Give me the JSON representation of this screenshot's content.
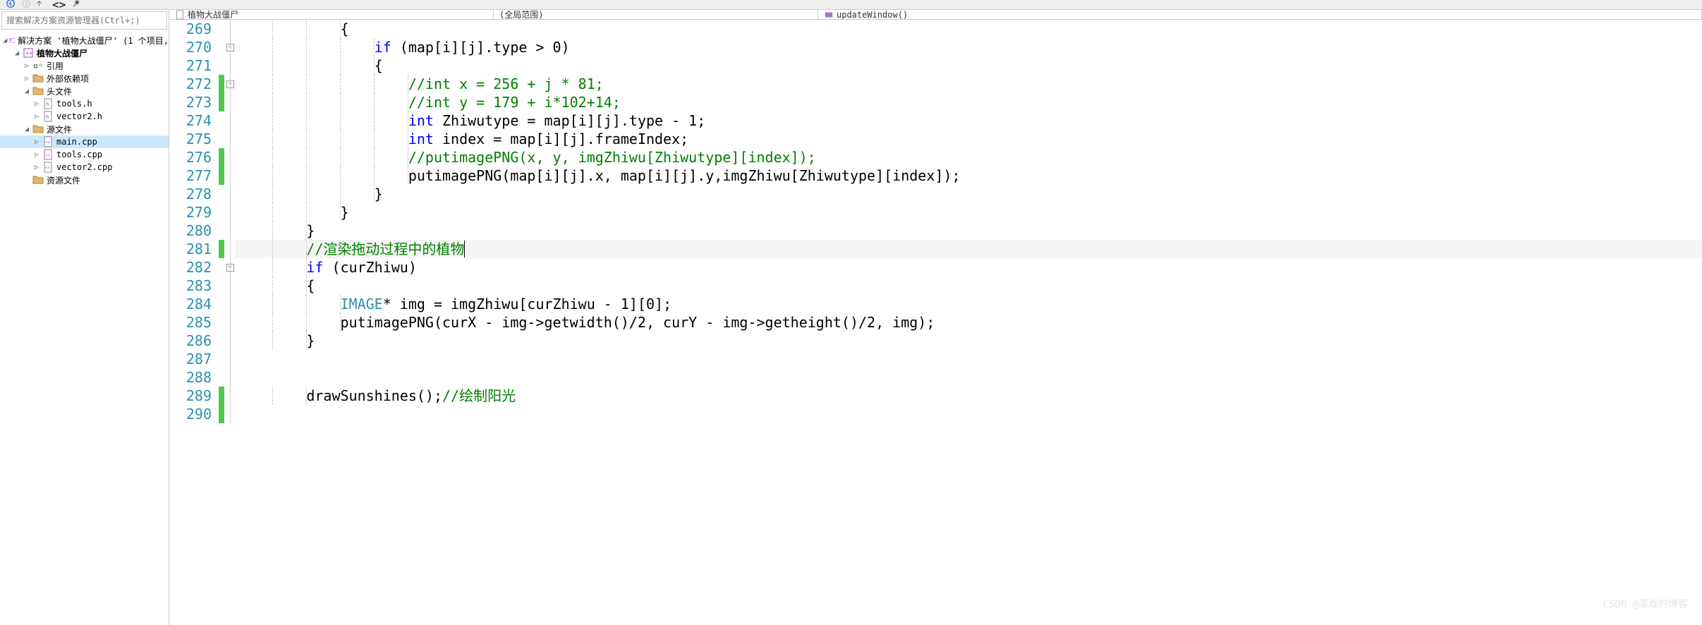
{
  "toolbar_icons": [
    "back-icon",
    "forward-icon",
    "chevron-icon",
    "branch-icon",
    "angle-icon"
  ],
  "search": {
    "placeholder": "搜索解决方案资源管理器(Ctrl+;)"
  },
  "nav": {
    "file": "植物大战僵尸",
    "scope": "(全局范围)",
    "func": "updateWindow()"
  },
  "tree": {
    "solution": "解决方案 '植物大战僵尸' (1 个项目,",
    "project": "植物大战僵尸",
    "refs": "引用",
    "external": "外部依赖项",
    "headers": "头文件",
    "h1": "tools.h",
    "h2": "vector2.h",
    "sources": "源文件",
    "s1": "main.cpp",
    "s2": "tools.cpp",
    "s3": "vector2.cpp",
    "resources": "资源文件"
  },
  "lines": [
    {
      "n": 269,
      "change": "",
      "fold": "",
      "code": [
        {
          "t": "            {",
          "cls": ""
        }
      ]
    },
    {
      "n": 270,
      "change": "",
      "fold": "box",
      "code": [
        {
          "t": "                ",
          "cls": ""
        },
        {
          "t": "if",
          "cls": "kw"
        },
        {
          "t": " (map[i][j].type > 0)",
          "cls": ""
        }
      ]
    },
    {
      "n": 271,
      "change": "",
      "fold": "",
      "code": [
        {
          "t": "                {",
          "cls": ""
        }
      ]
    },
    {
      "n": 272,
      "change": "green",
      "fold": "box",
      "code": [
        {
          "t": "                    ",
          "cls": ""
        },
        {
          "t": "//int x = 256 + j * 81;",
          "cls": "comment"
        }
      ]
    },
    {
      "n": 273,
      "change": "green",
      "fold": "",
      "code": [
        {
          "t": "                    ",
          "cls": ""
        },
        {
          "t": "//int y = 179 + i*102+14;",
          "cls": "comment"
        }
      ]
    },
    {
      "n": 274,
      "change": "",
      "fold": "",
      "code": [
        {
          "t": "                    ",
          "cls": ""
        },
        {
          "t": "int",
          "cls": "type"
        },
        {
          "t": " Zhiwutype = map[i][j].type - 1;",
          "cls": ""
        }
      ]
    },
    {
      "n": 275,
      "change": "",
      "fold": "",
      "code": [
        {
          "t": "                    ",
          "cls": ""
        },
        {
          "t": "int",
          "cls": "type"
        },
        {
          "t": " index = map[i][j].frameIndex;",
          "cls": ""
        }
      ]
    },
    {
      "n": 276,
      "change": "green",
      "fold": "",
      "code": [
        {
          "t": "                    ",
          "cls": ""
        },
        {
          "t": "//putimagePNG(x, y, imgZhiwu[Zhiwutype][index]);",
          "cls": "comment"
        }
      ]
    },
    {
      "n": 277,
      "change": "green",
      "fold": "",
      "code": [
        {
          "t": "                    putimagePNG(map[i][j].x, map[i][j].y,imgZhiwu[Zhiwutype][index]);",
          "cls": ""
        }
      ]
    },
    {
      "n": 278,
      "change": "",
      "fold": "",
      "code": [
        {
          "t": "                }",
          "cls": ""
        }
      ]
    },
    {
      "n": 279,
      "change": "",
      "fold": "",
      "code": [
        {
          "t": "            }",
          "cls": ""
        }
      ]
    },
    {
      "n": 280,
      "change": "",
      "fold": "",
      "code": [
        {
          "t": "        }",
          "cls": ""
        }
      ]
    },
    {
      "n": 281,
      "change": "green",
      "fold": "",
      "current": true,
      "code": [
        {
          "t": "        ",
          "cls": ""
        },
        {
          "t": "//渲染拖动过程中的植物",
          "cls": "comment"
        }
      ]
    },
    {
      "n": 282,
      "change": "",
      "fold": "box",
      "code": [
        {
          "t": "        ",
          "cls": ""
        },
        {
          "t": "if",
          "cls": "kw"
        },
        {
          "t": " (curZhiwu)",
          "cls": ""
        }
      ]
    },
    {
      "n": 283,
      "change": "",
      "fold": "",
      "code": [
        {
          "t": "        {",
          "cls": ""
        }
      ]
    },
    {
      "n": 284,
      "change": "",
      "fold": "",
      "code": [
        {
          "t": "            ",
          "cls": ""
        },
        {
          "t": "IMAGE",
          "cls": "cls"
        },
        {
          "t": "* img = imgZhiwu[curZhiwu - 1][0];",
          "cls": ""
        }
      ]
    },
    {
      "n": 285,
      "change": "",
      "fold": "",
      "code": [
        {
          "t": "            putimagePNG(curX - img->getwidth()/2, curY - img->getheight()/2, img);",
          "cls": ""
        }
      ]
    },
    {
      "n": 286,
      "change": "",
      "fold": "",
      "code": [
        {
          "t": "        }",
          "cls": ""
        }
      ]
    },
    {
      "n": 287,
      "change": "",
      "fold": "",
      "code": [
        {
          "t": "",
          "cls": ""
        }
      ]
    },
    {
      "n": 288,
      "change": "",
      "fold": "",
      "code": [
        {
          "t": "",
          "cls": ""
        }
      ]
    },
    {
      "n": 289,
      "change": "green",
      "fold": "",
      "code": [
        {
          "t": "        drawSunshines();",
          "cls": ""
        },
        {
          "t": "//绘制阳光",
          "cls": "comment"
        }
      ]
    },
    {
      "n": 290,
      "change": "green",
      "fold": "",
      "code": [
        {
          "t": "",
          "cls": ""
        }
      ]
    }
  ],
  "watermark": "CSDN @落戏的博客"
}
